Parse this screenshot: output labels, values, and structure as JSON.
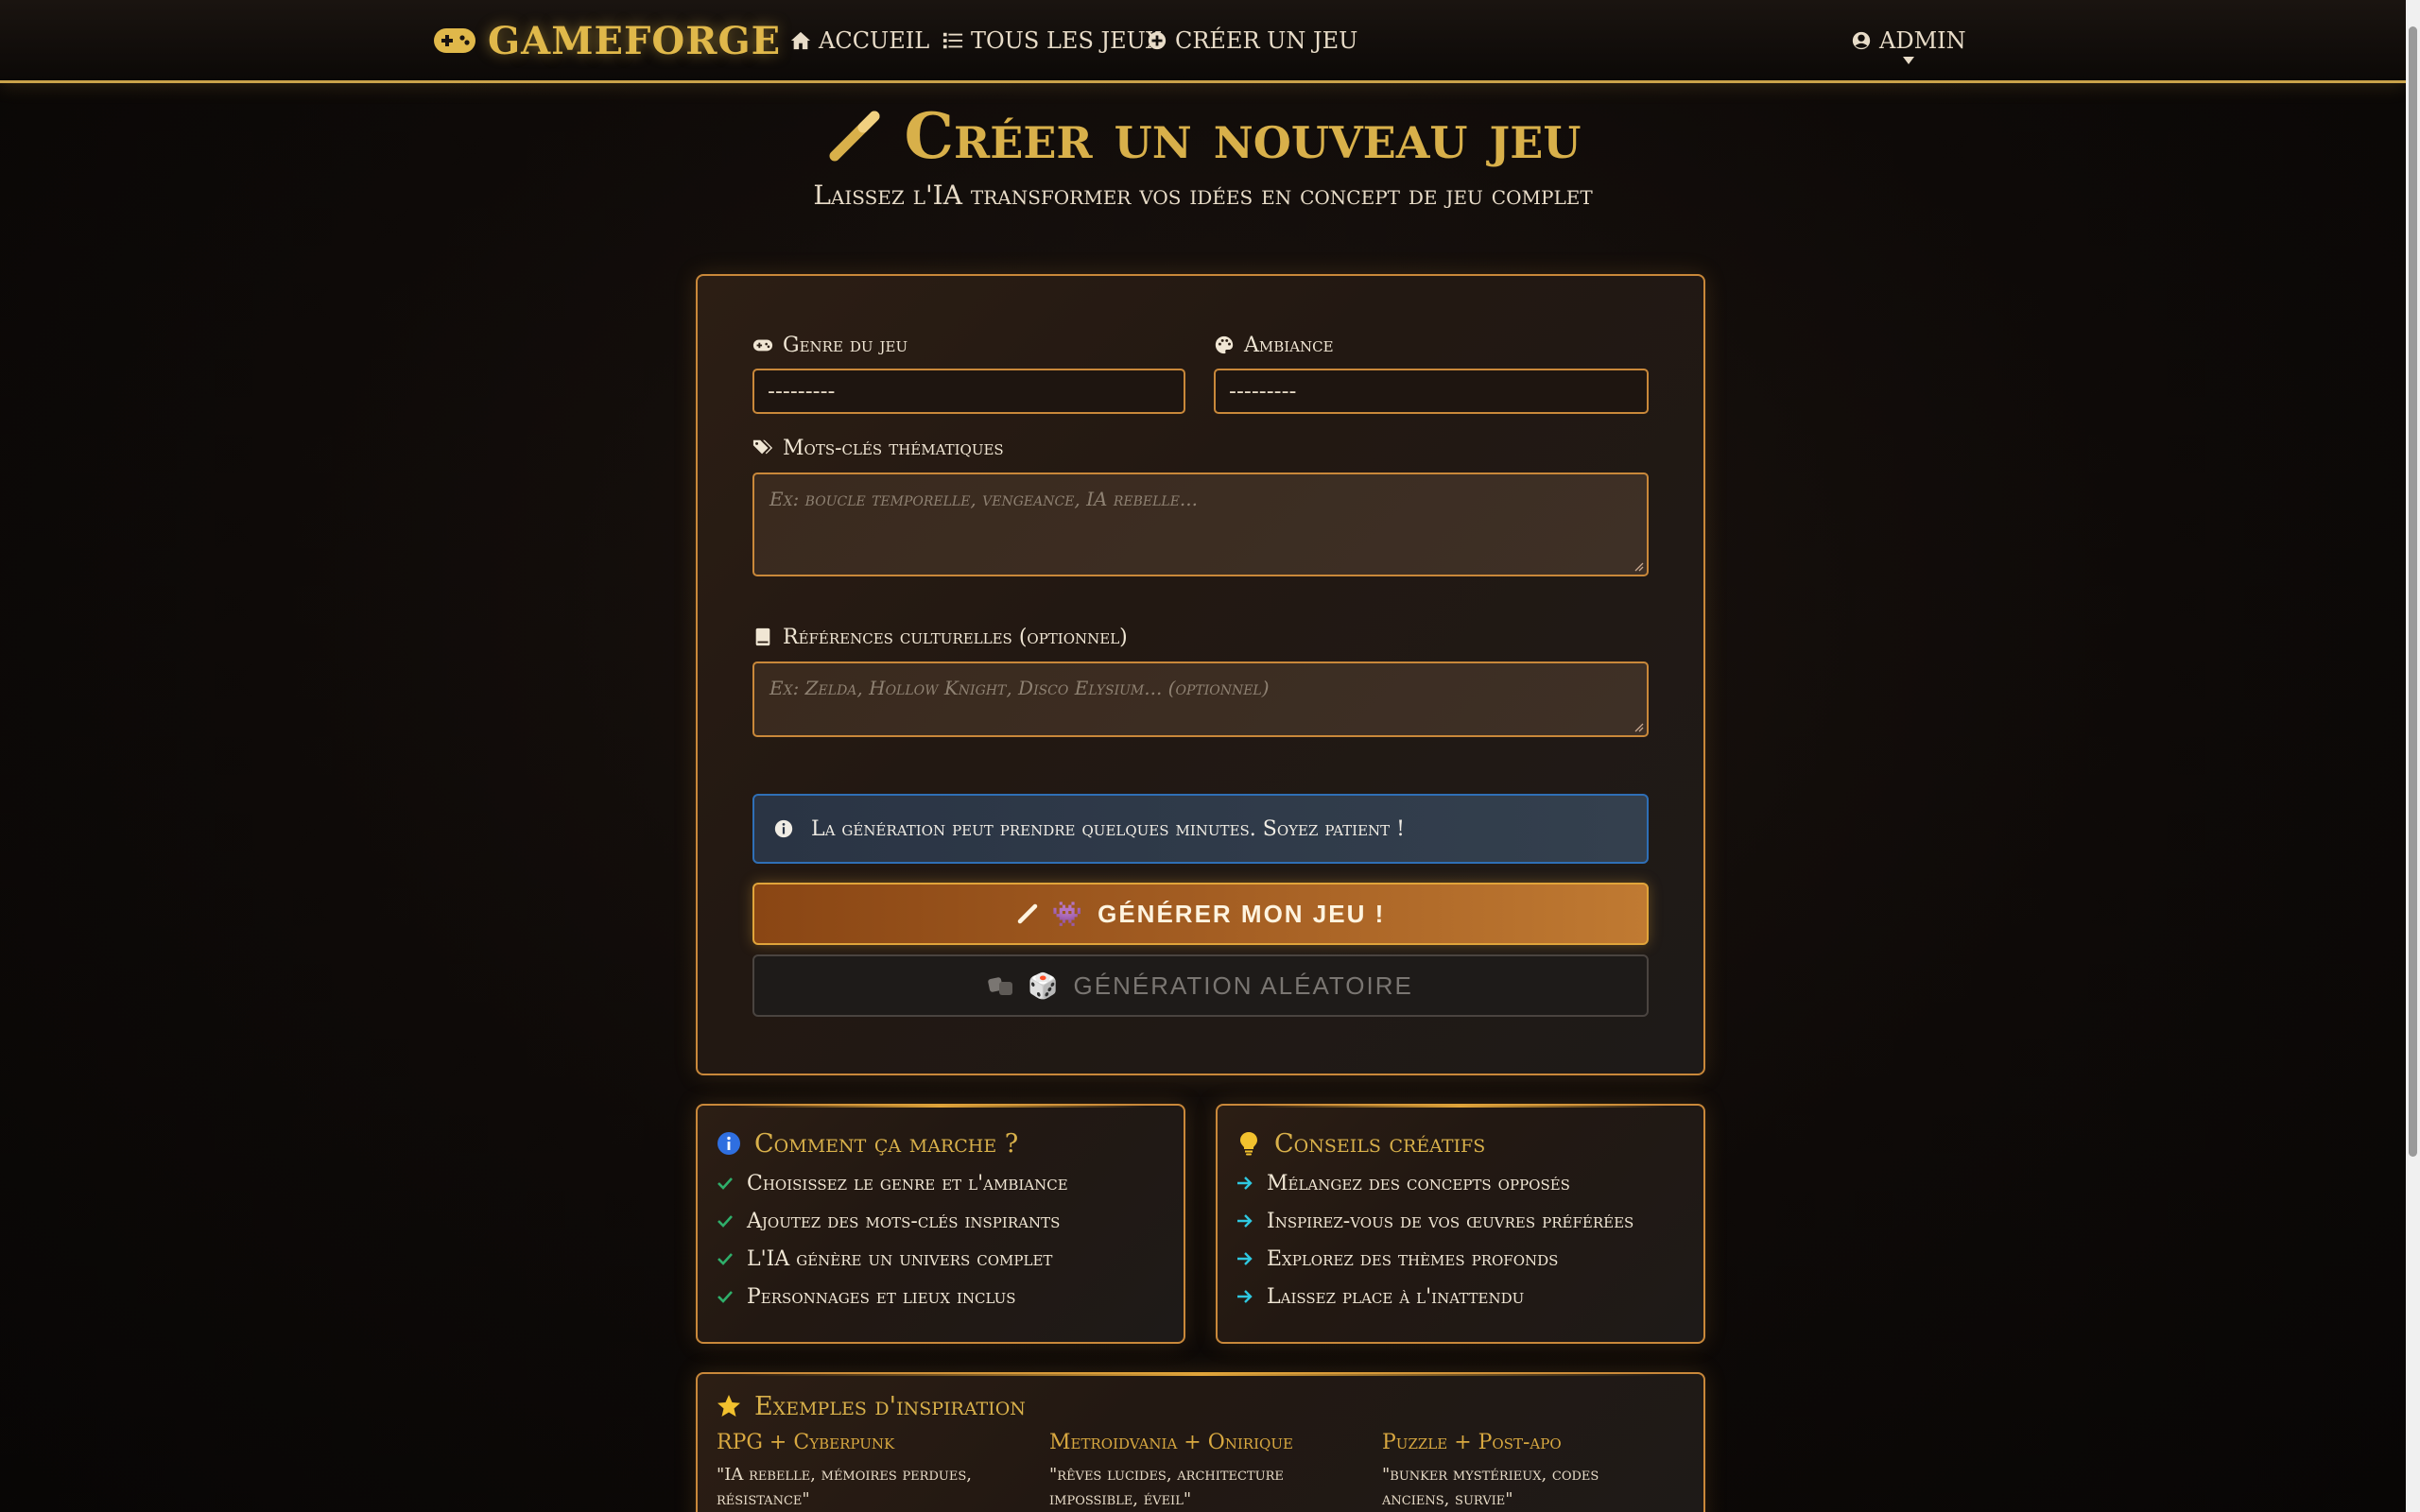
{
  "nav": {
    "brand": "GAMEFORGE",
    "links": [
      {
        "label": "ACCUEIL",
        "icon": "home-icon"
      },
      {
        "label": "TOUS LES JEUX",
        "icon": "list-icon"
      },
      {
        "label": "CRÉER UN JEU",
        "icon": "plus-circle-icon"
      }
    ],
    "user": "ADMIN"
  },
  "header": {
    "title": "Créer un nouveau jeu",
    "subtitle": "Laissez l'IA transformer vos idées en concept de jeu complet"
  },
  "form": {
    "genre_label": "Genre du jeu",
    "genre_value": "---------",
    "ambiance_label": "Ambiance",
    "ambiance_value": "---------",
    "keywords_label": "Mots-clés thématiques",
    "keywords_placeholder": "Ex: boucle temporelle, vengeance, IA rebelle...",
    "references_label": "Références culturelles (optionnel)",
    "references_placeholder": "Ex: Zelda, Hollow Knight, Disco Elysium... (optionnel)",
    "alert": "La génération peut prendre quelques minutes. Soyez patient !",
    "generate_label": "GÉNÉRER MON JEU !",
    "generate_emoji": "👾",
    "random_label": "GÉNÉRATION ALÉATOIRE",
    "random_emoji": "🎲"
  },
  "how_it_works": {
    "title": "Comment ça marche ?",
    "items": [
      "Choisissez le genre et l'ambiance",
      "Ajoutez des mots-clés inspirants",
      "L'IA génère un univers complet",
      "Personnages et lieux inclus"
    ]
  },
  "tips": {
    "title": "Conseils créatifs",
    "items": [
      "Mélangez des concepts opposés",
      "Inspirez-vous de vos œuvres préférées",
      "Explorez des thèmes profonds",
      "Laissez place à l'inattendu"
    ]
  },
  "examples": {
    "title": "Exemples d'inspiration",
    "items": [
      {
        "title": "RPG + Cyberpunk",
        "text": "\"IA rebelle, mémoires perdues, résistance\""
      },
      {
        "title": "Metroidvania + Onirique",
        "text": "\"rêves lucides, architecture impossible, éveil\""
      },
      {
        "title": "Puzzle + Post-apo",
        "text": "\"bunker mystérieux, codes anciens, survie\""
      }
    ]
  },
  "colors": {
    "accent_gold": "#d8b04a",
    "border_orange": "#c9883a",
    "info_blue": "#2f6fb6",
    "check_green": "#2fae6a",
    "arrow_cyan": "#2fc8e0"
  }
}
